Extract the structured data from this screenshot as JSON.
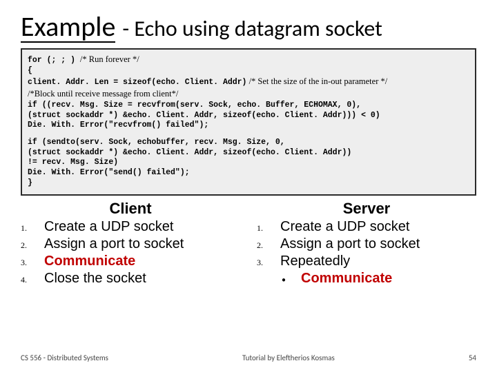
{
  "title": {
    "underlined": "Example",
    "rest": " - Echo using datagram socket"
  },
  "code": {
    "l1a": "for (; ; ) ",
    "l1b": "/* Run forever */",
    "l2": "{",
    "l3a": "    client. Addr. Len = sizeof(echo. Client. Addr)",
    "l3b": "    /* Set the size of the in-out parameter */",
    "l4b": "/*Block until receive message from client*/",
    "l5": "    if ((recv. Msg. Size = recvfrom(serv. Sock, echo. Buffer, ECHOMAX, 0),",
    "l6": "          (struct sockaddr *) &echo. Client. Addr, sizeof(echo. Client. Addr))) < 0)",
    "l7": "       Die. With. Error(\"recvfrom() failed\");",
    "l8": "   if (sendto(serv. Sock, echobuffer, recv. Msg. Size, 0,",
    "l9": "                     (struct sockaddr *) &echo. Client. Addr, sizeof(echo. Client. Addr))",
    "l10": "            != recv. Msg. Size)",
    "l11": "       Die. With. Error(\"send() failed\");",
    "l12": "}"
  },
  "client": {
    "head": "Client",
    "items": [
      "Create a UDP socket",
      "Assign a port to socket",
      "Communicate",
      "Close the socket"
    ]
  },
  "server": {
    "head": "Server",
    "items": [
      "Create a UDP socket",
      "Assign a port to socket",
      "Repeatedly"
    ],
    "sub": "Communicate"
  },
  "footer": {
    "left": "CS 556 - Distributed Systems",
    "center": "Tutorial by Eleftherios Kosmas",
    "right": "54"
  }
}
